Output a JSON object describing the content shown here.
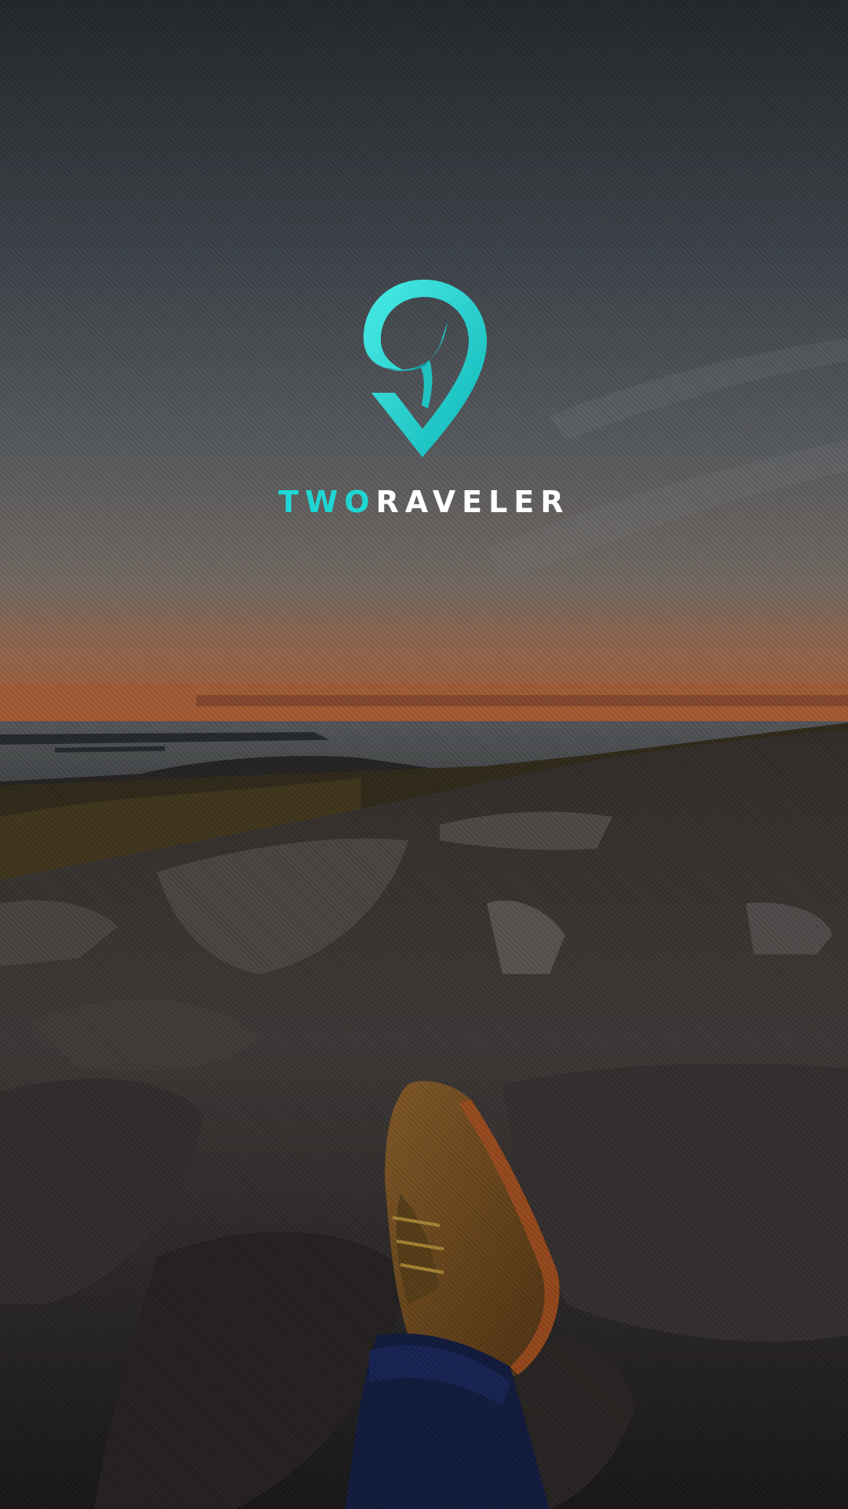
{
  "splash": {
    "brand_accent": "TWO",
    "brand_rest": "RAVELER"
  },
  "icons": {
    "logo": "map-pin-logo-icon"
  },
  "colors": {
    "accent": "#1ed7d4",
    "text": "#ffffff"
  }
}
